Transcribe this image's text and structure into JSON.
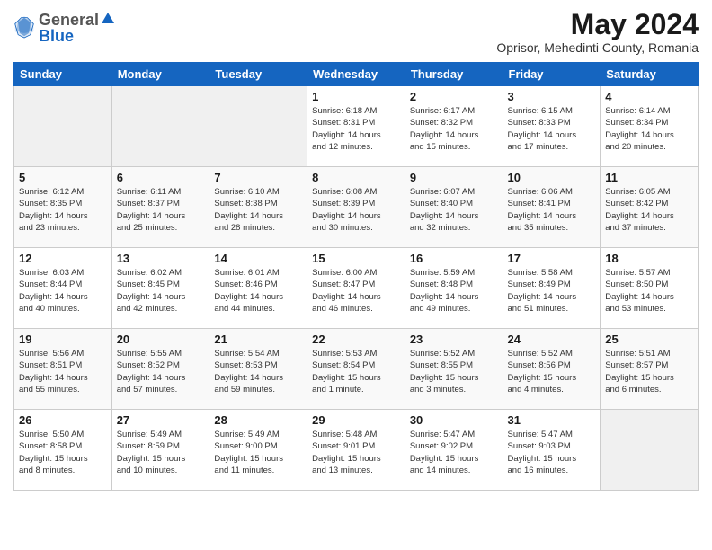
{
  "header": {
    "logo_general": "General",
    "logo_blue": "Blue",
    "month_year": "May 2024",
    "location": "Oprisor, Mehedinti County, Romania"
  },
  "weekdays": [
    "Sunday",
    "Monday",
    "Tuesday",
    "Wednesday",
    "Thursday",
    "Friday",
    "Saturday"
  ],
  "weeks": [
    [
      {
        "day": "",
        "info": ""
      },
      {
        "day": "",
        "info": ""
      },
      {
        "day": "",
        "info": ""
      },
      {
        "day": "1",
        "info": "Sunrise: 6:18 AM\nSunset: 8:31 PM\nDaylight: 14 hours\nand 12 minutes."
      },
      {
        "day": "2",
        "info": "Sunrise: 6:17 AM\nSunset: 8:32 PM\nDaylight: 14 hours\nand 15 minutes."
      },
      {
        "day": "3",
        "info": "Sunrise: 6:15 AM\nSunset: 8:33 PM\nDaylight: 14 hours\nand 17 minutes."
      },
      {
        "day": "4",
        "info": "Sunrise: 6:14 AM\nSunset: 8:34 PM\nDaylight: 14 hours\nand 20 minutes."
      }
    ],
    [
      {
        "day": "5",
        "info": "Sunrise: 6:12 AM\nSunset: 8:35 PM\nDaylight: 14 hours\nand 23 minutes."
      },
      {
        "day": "6",
        "info": "Sunrise: 6:11 AM\nSunset: 8:37 PM\nDaylight: 14 hours\nand 25 minutes."
      },
      {
        "day": "7",
        "info": "Sunrise: 6:10 AM\nSunset: 8:38 PM\nDaylight: 14 hours\nand 28 minutes."
      },
      {
        "day": "8",
        "info": "Sunrise: 6:08 AM\nSunset: 8:39 PM\nDaylight: 14 hours\nand 30 minutes."
      },
      {
        "day": "9",
        "info": "Sunrise: 6:07 AM\nSunset: 8:40 PM\nDaylight: 14 hours\nand 32 minutes."
      },
      {
        "day": "10",
        "info": "Sunrise: 6:06 AM\nSunset: 8:41 PM\nDaylight: 14 hours\nand 35 minutes."
      },
      {
        "day": "11",
        "info": "Sunrise: 6:05 AM\nSunset: 8:42 PM\nDaylight: 14 hours\nand 37 minutes."
      }
    ],
    [
      {
        "day": "12",
        "info": "Sunrise: 6:03 AM\nSunset: 8:44 PM\nDaylight: 14 hours\nand 40 minutes."
      },
      {
        "day": "13",
        "info": "Sunrise: 6:02 AM\nSunset: 8:45 PM\nDaylight: 14 hours\nand 42 minutes."
      },
      {
        "day": "14",
        "info": "Sunrise: 6:01 AM\nSunset: 8:46 PM\nDaylight: 14 hours\nand 44 minutes."
      },
      {
        "day": "15",
        "info": "Sunrise: 6:00 AM\nSunset: 8:47 PM\nDaylight: 14 hours\nand 46 minutes."
      },
      {
        "day": "16",
        "info": "Sunrise: 5:59 AM\nSunset: 8:48 PM\nDaylight: 14 hours\nand 49 minutes."
      },
      {
        "day": "17",
        "info": "Sunrise: 5:58 AM\nSunset: 8:49 PM\nDaylight: 14 hours\nand 51 minutes."
      },
      {
        "day": "18",
        "info": "Sunrise: 5:57 AM\nSunset: 8:50 PM\nDaylight: 14 hours\nand 53 minutes."
      }
    ],
    [
      {
        "day": "19",
        "info": "Sunrise: 5:56 AM\nSunset: 8:51 PM\nDaylight: 14 hours\nand 55 minutes."
      },
      {
        "day": "20",
        "info": "Sunrise: 5:55 AM\nSunset: 8:52 PM\nDaylight: 14 hours\nand 57 minutes."
      },
      {
        "day": "21",
        "info": "Sunrise: 5:54 AM\nSunset: 8:53 PM\nDaylight: 14 hours\nand 59 minutes."
      },
      {
        "day": "22",
        "info": "Sunrise: 5:53 AM\nSunset: 8:54 PM\nDaylight: 15 hours\nand 1 minute."
      },
      {
        "day": "23",
        "info": "Sunrise: 5:52 AM\nSunset: 8:55 PM\nDaylight: 15 hours\nand 3 minutes."
      },
      {
        "day": "24",
        "info": "Sunrise: 5:52 AM\nSunset: 8:56 PM\nDaylight: 15 hours\nand 4 minutes."
      },
      {
        "day": "25",
        "info": "Sunrise: 5:51 AM\nSunset: 8:57 PM\nDaylight: 15 hours\nand 6 minutes."
      }
    ],
    [
      {
        "day": "26",
        "info": "Sunrise: 5:50 AM\nSunset: 8:58 PM\nDaylight: 15 hours\nand 8 minutes."
      },
      {
        "day": "27",
        "info": "Sunrise: 5:49 AM\nSunset: 8:59 PM\nDaylight: 15 hours\nand 10 minutes."
      },
      {
        "day": "28",
        "info": "Sunrise: 5:49 AM\nSunset: 9:00 PM\nDaylight: 15 hours\nand 11 minutes."
      },
      {
        "day": "29",
        "info": "Sunrise: 5:48 AM\nSunset: 9:01 PM\nDaylight: 15 hours\nand 13 minutes."
      },
      {
        "day": "30",
        "info": "Sunrise: 5:47 AM\nSunset: 9:02 PM\nDaylight: 15 hours\nand 14 minutes."
      },
      {
        "day": "31",
        "info": "Sunrise: 5:47 AM\nSunset: 9:03 PM\nDaylight: 15 hours\nand 16 minutes."
      },
      {
        "day": "",
        "info": ""
      }
    ]
  ]
}
